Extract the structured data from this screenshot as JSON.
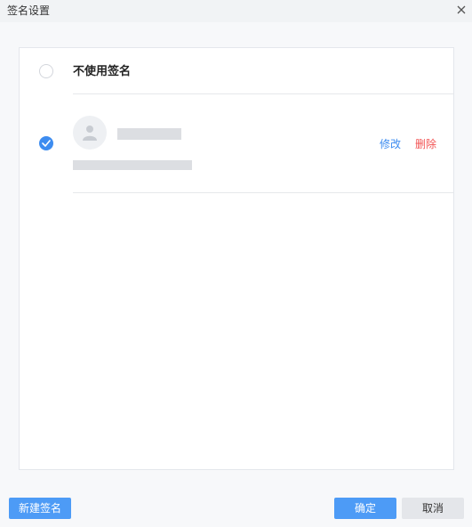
{
  "dialog": {
    "title": "签名设置"
  },
  "options": [
    {
      "label": "不使用签名",
      "selected": false
    },
    {
      "selected": true,
      "actions": {
        "edit": "修改",
        "delete": "删除"
      }
    }
  ],
  "footer": {
    "new_label": "新建签名",
    "confirm_label": "确定",
    "cancel_label": "取消"
  },
  "colors": {
    "accent": "#3d8cf0",
    "danger": "#f25353",
    "primary_button": "#4d9bf6"
  },
  "icons": {
    "close": "close-icon",
    "check": "check-icon",
    "avatar": "user-icon"
  }
}
